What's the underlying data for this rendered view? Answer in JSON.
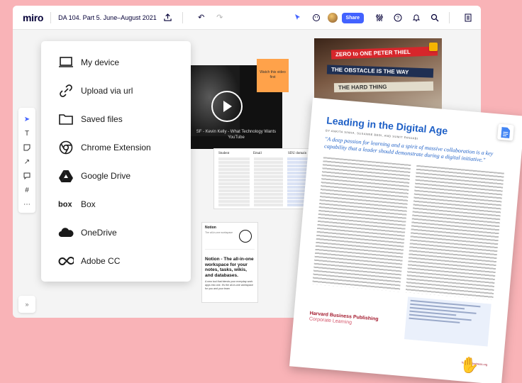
{
  "topbar": {
    "logo": "miro",
    "board_title": "DA 104. Part 5. June–August 2021",
    "share_label": "Share"
  },
  "upload_menu": {
    "items": [
      {
        "label": "My device",
        "icon": "laptop-icon"
      },
      {
        "label": "Upload via url",
        "icon": "link-icon"
      },
      {
        "label": "Saved files",
        "icon": "folder-icon"
      },
      {
        "label": "Chrome Extension",
        "icon": "chrome-icon"
      },
      {
        "label": "Google Drive",
        "icon": "google-drive-icon"
      },
      {
        "label": "Box",
        "icon": "box-icon"
      },
      {
        "label": "OneDrive",
        "icon": "onedrive-icon"
      },
      {
        "label": "Adobe CC",
        "icon": "adobe-cc-icon"
      }
    ]
  },
  "canvas": {
    "video_caption": "SF - Kevin Kelly - What Technology Wants",
    "video_source": "YouTube",
    "sticky_note": "Watch this video first",
    "books": [
      "ZERO to ONE  PETER THIEL",
      "THE OBSTACLE IS THE WAY",
      "THE HARD THING"
    ],
    "sheet_headers": [
      "Student",
      "Email",
      "SDU domain"
    ],
    "notion_card": {
      "title": "Notion",
      "subtitle": "The all-in-one workspace",
      "heading": "Notion - The all-in-one workspace for your notes, tasks, wikis, and databases.",
      "body": "A new tool that blends your everyday work apps into one. It's the all-in-one workspace for you and your team"
    },
    "article": {
      "title": "Leading in the Digital Age",
      "authors": "BY ANKITA SINHA, SUSANNE BEDI, AND SUMIT PANJABI",
      "quote": "\"A deep passion for learning and a spirit of massive collaboration is a key capability that a leader should demonstrate during a digital initiative.\"",
      "publisher": "Harvard Business Publishing",
      "publisher_sub": "Corporate Learning",
      "url": "harvardbusiness.org"
    }
  },
  "colors": {
    "background": "#f9b3b7",
    "accent": "#4262ff",
    "sticky": "#ffa24a",
    "article_blue": "#1d5fc6",
    "hbp_red": "#a3182c"
  }
}
